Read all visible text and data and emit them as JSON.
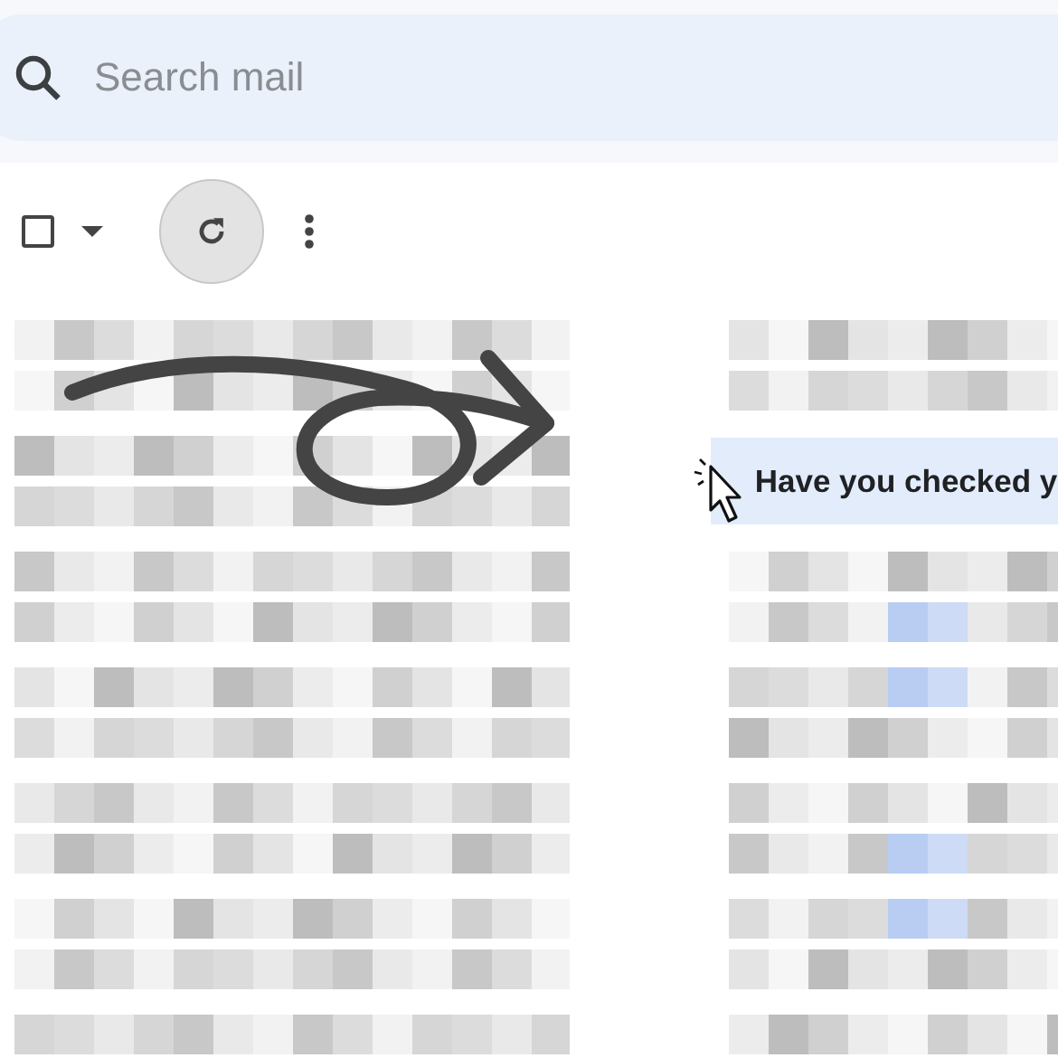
{
  "search": {
    "placeholder": "Search mail"
  },
  "toolbar": {
    "select_all": {
      "checked": false
    }
  },
  "rows": [
    {
      "kind": "blurred"
    },
    {
      "kind": "subject",
      "subject": "Have you checked y"
    },
    {
      "kind": "blurred"
    },
    {
      "kind": "blurred"
    },
    {
      "kind": "blurred"
    },
    {
      "kind": "blurred"
    },
    {
      "kind": "blurred"
    }
  ]
}
